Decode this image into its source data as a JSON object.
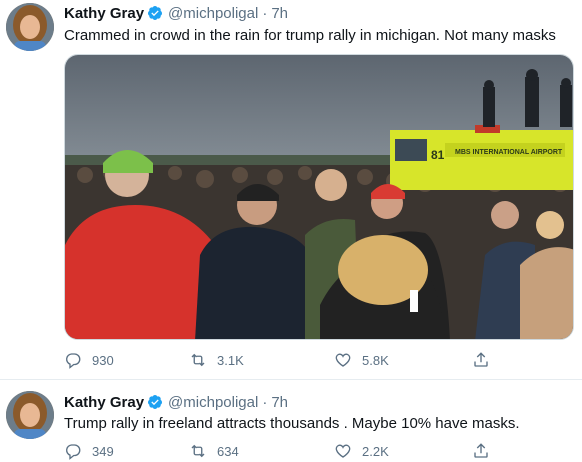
{
  "tweets": [
    {
      "author": {
        "name": "Kathy Gray",
        "handle": "@michpoligal",
        "verified": true,
        "avatar": "profile-photo"
      },
      "time": "7h",
      "text": "Crammed in crowd in the rain for trump rally in michigan. Not many masks",
      "media": {
        "vehicle_text": "MBS INTERNATIONAL AIRPORT",
        "vehicle_number": "81"
      },
      "actions": {
        "replies": "930",
        "retweets": "3.1K",
        "likes": "5.8K"
      }
    },
    {
      "author": {
        "name": "Kathy Gray",
        "handle": "@michpoligal",
        "verified": true,
        "avatar": "profile-photo"
      },
      "time": "7h",
      "text": "Trump rally in freeland attracts thousands . Maybe 10% have masks.",
      "actions": {
        "replies": "349",
        "retweets": "634",
        "likes": "2.2K"
      }
    }
  ],
  "separator": "·",
  "icons": [
    "verified-badge-icon",
    "reply-icon",
    "retweet-icon",
    "like-icon",
    "share-icon"
  ],
  "colors": {
    "accent": "#1da1f2",
    "muted": "#5b7083",
    "text": "#0f1419",
    "border": "#e6ecf0"
  }
}
